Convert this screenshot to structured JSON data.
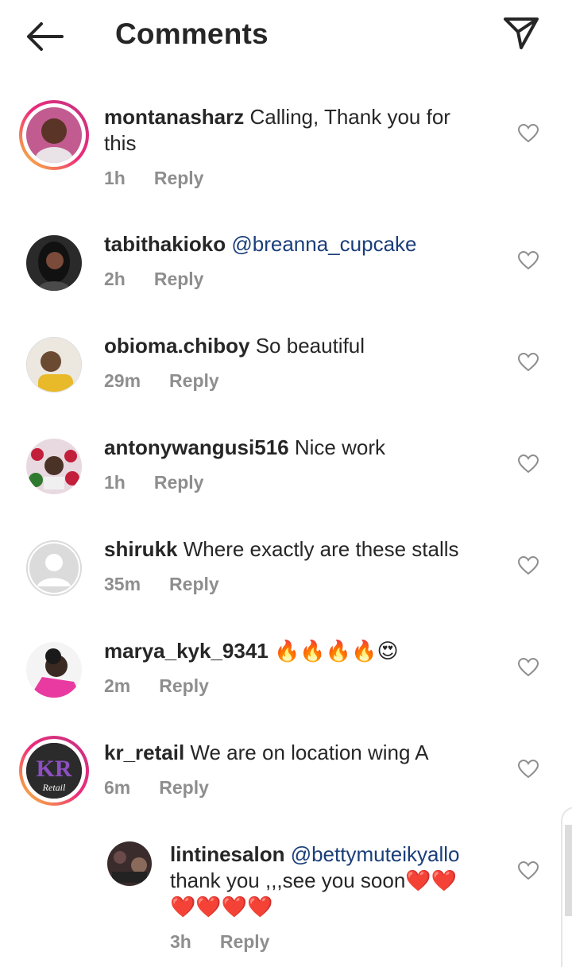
{
  "header": {
    "title": "Comments"
  },
  "comments": [
    {
      "username": "montanasharz",
      "text": "Calling, Thank you for",
      "text2": "this",
      "mention": "",
      "time": "1h",
      "reply": "Reply"
    },
    {
      "username": "tabithakioko",
      "text": "",
      "mention": "@breanna_cupcake",
      "time": "2h",
      "reply": "Reply"
    },
    {
      "username": "obioma.chiboy",
      "text": "So beautiful",
      "mention": "",
      "time": "29m",
      "reply": "Reply"
    },
    {
      "username": "antonywangusi516",
      "text": "Nice work",
      "mention": "",
      "time": "1h",
      "reply": "Reply"
    },
    {
      "username": "shirukk",
      "text": "Where exactly are these stalls",
      "mention": "",
      "time": "35m",
      "reply": "Reply"
    },
    {
      "username": "marya_kyk_9341",
      "text": "🔥🔥🔥🔥😍",
      "mention": "",
      "time": "2m",
      "reply": "Reply"
    },
    {
      "username": "kr_retail",
      "text": "We are on location wing A",
      "mention": "",
      "time": "6m",
      "reply": "Reply",
      "avatar_text": "KR",
      "avatar_sub": "Retail"
    },
    {
      "username": "lintinesalon",
      "mention": "@bettymuteikyallo",
      "text": "thank you ,,,see you soon❤️❤️",
      "text2": "❤️❤️❤️❤️",
      "time": "3h",
      "reply": "Reply"
    }
  ],
  "colors": {
    "mention": "#1a3e7a",
    "meta": "#8e8e8e",
    "text": "#262626"
  }
}
